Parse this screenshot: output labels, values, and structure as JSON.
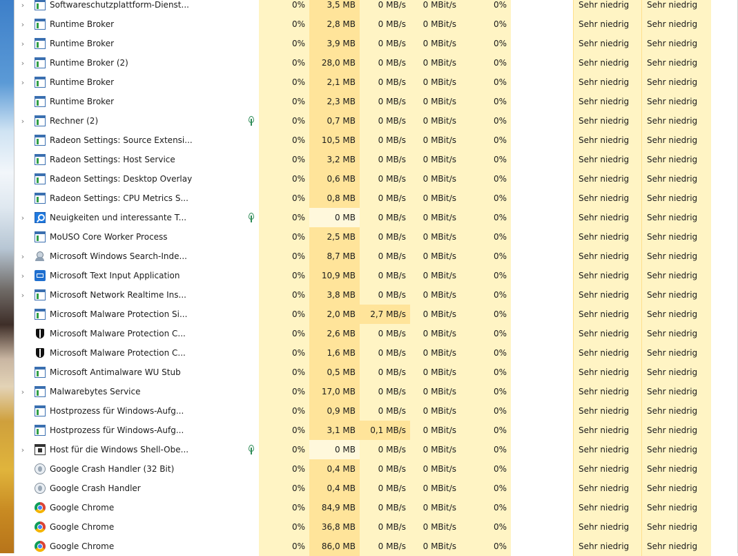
{
  "processes": [
    {
      "expandable": true,
      "icon": "window-icon",
      "name": "Softwareschutzplattform-Dienst...",
      "cpu": "0%",
      "mem": "3,5 MB",
      "disk": "0 MB/s",
      "net": "0 MBit/s",
      "gpu": "0%",
      "power": "Sehr niedrig",
      "power_trend": "Sehr niedrig",
      "eco": false
    },
    {
      "expandable": true,
      "icon": "window-icon",
      "name": "Runtime Broker",
      "cpu": "0%",
      "mem": "2,8 MB",
      "disk": "0 MB/s",
      "net": "0 MBit/s",
      "gpu": "0%",
      "power": "Sehr niedrig",
      "power_trend": "Sehr niedrig",
      "eco": false
    },
    {
      "expandable": true,
      "icon": "window-icon",
      "name": "Runtime Broker",
      "cpu": "0%",
      "mem": "3,9 MB",
      "disk": "0 MB/s",
      "net": "0 MBit/s",
      "gpu": "0%",
      "power": "Sehr niedrig",
      "power_trend": "Sehr niedrig",
      "eco": false
    },
    {
      "expandable": true,
      "icon": "window-icon",
      "name": "Runtime Broker (2)",
      "cpu": "0%",
      "mem": "28,0 MB",
      "disk": "0 MB/s",
      "net": "0 MBit/s",
      "gpu": "0%",
      "power": "Sehr niedrig",
      "power_trend": "Sehr niedrig",
      "eco": false
    },
    {
      "expandable": true,
      "icon": "window-icon",
      "name": "Runtime Broker",
      "cpu": "0%",
      "mem": "2,1 MB",
      "disk": "0 MB/s",
      "net": "0 MBit/s",
      "gpu": "0%",
      "power": "Sehr niedrig",
      "power_trend": "Sehr niedrig",
      "eco": false
    },
    {
      "expandable": false,
      "icon": "window-icon",
      "name": "Runtime Broker",
      "cpu": "0%",
      "mem": "2,3 MB",
      "disk": "0 MB/s",
      "net": "0 MBit/s",
      "gpu": "0%",
      "power": "Sehr niedrig",
      "power_trend": "Sehr niedrig",
      "eco": false
    },
    {
      "expandable": true,
      "icon": "window-icon",
      "name": "Rechner (2)",
      "cpu": "0%",
      "mem": "0,7 MB",
      "disk": "0 MB/s",
      "net": "0 MBit/s",
      "gpu": "0%",
      "power": "Sehr niedrig",
      "power_trend": "Sehr niedrig",
      "eco": true
    },
    {
      "expandable": false,
      "icon": "window-icon",
      "name": "Radeon Settings: Source Extensi...",
      "cpu": "0%",
      "mem": "10,5 MB",
      "disk": "0 MB/s",
      "net": "0 MBit/s",
      "gpu": "0%",
      "power": "Sehr niedrig",
      "power_trend": "Sehr niedrig",
      "eco": false
    },
    {
      "expandable": false,
      "icon": "window-icon",
      "name": "Radeon Settings: Host Service",
      "cpu": "0%",
      "mem": "3,2 MB",
      "disk": "0 MB/s",
      "net": "0 MBit/s",
      "gpu": "0%",
      "power": "Sehr niedrig",
      "power_trend": "Sehr niedrig",
      "eco": false
    },
    {
      "expandable": false,
      "icon": "window-icon",
      "name": "Radeon Settings: Desktop Overlay",
      "cpu": "0%",
      "mem": "0,6 MB",
      "disk": "0 MB/s",
      "net": "0 MBit/s",
      "gpu": "0%",
      "power": "Sehr niedrig",
      "power_trend": "Sehr niedrig",
      "eco": false
    },
    {
      "expandable": false,
      "icon": "window-icon",
      "name": "Radeon Settings: CPU Metrics S...",
      "cpu": "0%",
      "mem": "0,8 MB",
      "disk": "0 MB/s",
      "net": "0 MBit/s",
      "gpu": "0%",
      "power": "Sehr niedrig",
      "power_trend": "Sehr niedrig",
      "eco": false
    },
    {
      "expandable": true,
      "icon": "search-icon",
      "name": "Neuigkeiten und interessante T...",
      "cpu": "0%",
      "mem": "0 MB",
      "disk": "0 MB/s",
      "net": "0 MBit/s",
      "gpu": "0%",
      "power": "Sehr niedrig",
      "power_trend": "Sehr niedrig",
      "eco": true
    },
    {
      "expandable": false,
      "icon": "window-icon",
      "name": "MoUSO Core Worker Process",
      "cpu": "0%",
      "mem": "2,5 MB",
      "disk": "0 MB/s",
      "net": "0 MBit/s",
      "gpu": "0%",
      "power": "Sehr niedrig",
      "power_trend": "Sehr niedrig",
      "eco": false
    },
    {
      "expandable": true,
      "icon": "user-icon",
      "name": "Microsoft Windows Search-Inde...",
      "cpu": "0%",
      "mem": "8,7 MB",
      "disk": "0 MB/s",
      "net": "0 MBit/s",
      "gpu": "0%",
      "power": "Sehr niedrig",
      "power_trend": "Sehr niedrig",
      "eco": false
    },
    {
      "expandable": true,
      "icon": "keyboard-icon",
      "name": "Microsoft Text Input Application",
      "cpu": "0%",
      "mem": "10,9 MB",
      "disk": "0 MB/s",
      "net": "0 MBit/s",
      "gpu": "0%",
      "power": "Sehr niedrig",
      "power_trend": "Sehr niedrig",
      "eco": false
    },
    {
      "expandable": true,
      "icon": "window-icon",
      "name": "Microsoft Network Realtime Ins...",
      "cpu": "0%",
      "mem": "3,8 MB",
      "disk": "0 MB/s",
      "net": "0 MBit/s",
      "gpu": "0%",
      "power": "Sehr niedrig",
      "power_trend": "Sehr niedrig",
      "eco": false
    },
    {
      "expandable": false,
      "icon": "window-icon",
      "name": "Microsoft Malware Protection Si...",
      "cpu": "0%",
      "mem": "2,0 MB",
      "disk": "2,7 MB/s",
      "net": "0 MBit/s",
      "gpu": "0%",
      "power": "Sehr niedrig",
      "power_trend": "Sehr niedrig",
      "eco": false
    },
    {
      "expandable": false,
      "icon": "shield-icon",
      "name": "Microsoft Malware Protection C...",
      "cpu": "0%",
      "mem": "2,6 MB",
      "disk": "0 MB/s",
      "net": "0 MBit/s",
      "gpu": "0%",
      "power": "Sehr niedrig",
      "power_trend": "Sehr niedrig",
      "eco": false
    },
    {
      "expandable": false,
      "icon": "shield-icon",
      "name": "Microsoft Malware Protection C...",
      "cpu": "0%",
      "mem": "1,6 MB",
      "disk": "0 MB/s",
      "net": "0 MBit/s",
      "gpu": "0%",
      "power": "Sehr niedrig",
      "power_trend": "Sehr niedrig",
      "eco": false
    },
    {
      "expandable": false,
      "icon": "window-icon",
      "name": "Microsoft Antimalware WU Stub",
      "cpu": "0%",
      "mem": "0,5 MB",
      "disk": "0 MB/s",
      "net": "0 MBit/s",
      "gpu": "0%",
      "power": "Sehr niedrig",
      "power_trend": "Sehr niedrig",
      "eco": false
    },
    {
      "expandable": true,
      "icon": "window-icon",
      "name": "Malwarebytes Service",
      "cpu": "0%",
      "mem": "17,0 MB",
      "disk": "0 MB/s",
      "net": "0 MBit/s",
      "gpu": "0%",
      "power": "Sehr niedrig",
      "power_trend": "Sehr niedrig",
      "eco": false
    },
    {
      "expandable": false,
      "icon": "window-icon",
      "name": "Hostprozess für Windows-Aufg...",
      "cpu": "0%",
      "mem": "0,9 MB",
      "disk": "0 MB/s",
      "net": "0 MBit/s",
      "gpu": "0%",
      "power": "Sehr niedrig",
      "power_trend": "Sehr niedrig",
      "eco": false
    },
    {
      "expandable": false,
      "icon": "window-icon",
      "name": "Hostprozess für Windows-Aufg...",
      "cpu": "0%",
      "mem": "3,1 MB",
      "disk": "0,1 MB/s",
      "net": "0 MBit/s",
      "gpu": "0%",
      "power": "Sehr niedrig",
      "power_trend": "Sehr niedrig",
      "eco": false
    },
    {
      "expandable": true,
      "icon": "shell-icon",
      "name": "Host für die Windows Shell-Obe...",
      "cpu": "0%",
      "mem": "0 MB",
      "disk": "0 MB/s",
      "net": "0 MBit/s",
      "gpu": "0%",
      "power": "Sehr niedrig",
      "power_trend": "Sehr niedrig",
      "eco": true
    },
    {
      "expandable": false,
      "icon": "crash-icon",
      "name": "Google Crash Handler (32 Bit)",
      "cpu": "0%",
      "mem": "0,4 MB",
      "disk": "0 MB/s",
      "net": "0 MBit/s",
      "gpu": "0%",
      "power": "Sehr niedrig",
      "power_trend": "Sehr niedrig",
      "eco": false
    },
    {
      "expandable": false,
      "icon": "crash-icon",
      "name": "Google Crash Handler",
      "cpu": "0%",
      "mem": "0,4 MB",
      "disk": "0 MB/s",
      "net": "0 MBit/s",
      "gpu": "0%",
      "power": "Sehr niedrig",
      "power_trend": "Sehr niedrig",
      "eco": false
    },
    {
      "expandable": false,
      "icon": "chrome-icon",
      "name": "Google Chrome",
      "cpu": "0%",
      "mem": "84,9 MB",
      "disk": "0 MB/s",
      "net": "0 MBit/s",
      "gpu": "0%",
      "power": "Sehr niedrig",
      "power_trend": "Sehr niedrig",
      "eco": false
    },
    {
      "expandable": false,
      "icon": "chrome-icon",
      "name": "Google Chrome",
      "cpu": "0%",
      "mem": "36,8 MB",
      "disk": "0 MB/s",
      "net": "0 MBit/s",
      "gpu": "0%",
      "power": "Sehr niedrig",
      "power_trend": "Sehr niedrig",
      "eco": false
    },
    {
      "expandable": false,
      "icon": "chrome-icon",
      "name": "Google Chrome",
      "cpu": "0%",
      "mem": "86,0 MB",
      "disk": "0 MB/s",
      "net": "0 MBit/s",
      "gpu": "0%",
      "power": "Sehr niedrig",
      "power_trend": "Sehr niedrig",
      "eco": false
    }
  ],
  "colors": {
    "heat_light": "#fff4c4",
    "heat_medium": "#ffe9a8",
    "eco_leaf": "#2e8b57"
  }
}
